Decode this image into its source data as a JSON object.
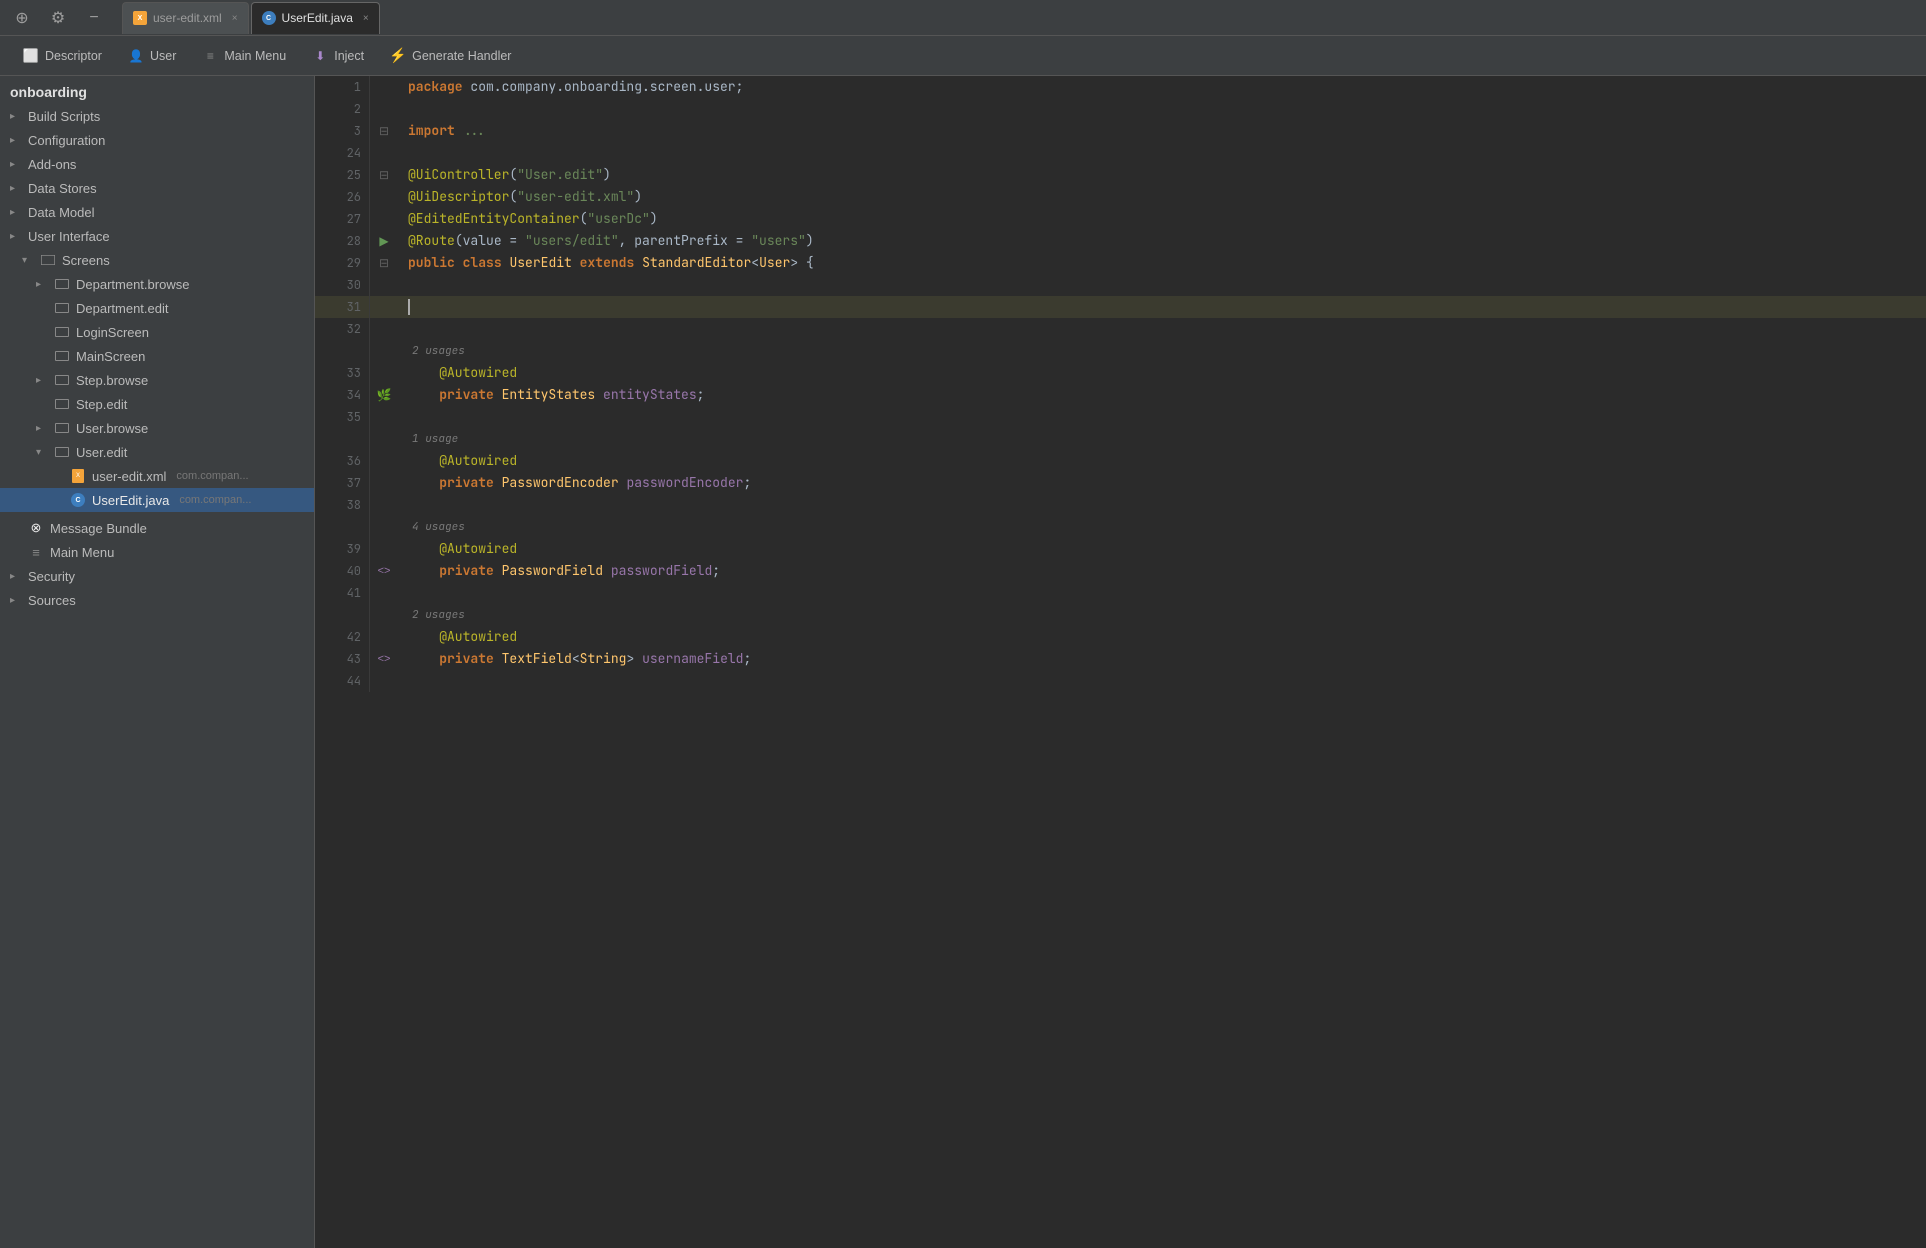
{
  "tabs": [
    {
      "id": "user-edit-xml",
      "label": "user-edit.xml",
      "type": "xml",
      "active": false
    },
    {
      "id": "UserEdit-java",
      "label": "UserEdit.java",
      "type": "java",
      "active": true
    }
  ],
  "toolbar": {
    "buttons": [
      {
        "id": "descriptor",
        "label": "Descriptor",
        "icon": "descriptor-icon"
      },
      {
        "id": "user",
        "label": "User",
        "icon": "user-icon"
      },
      {
        "id": "main-menu",
        "label": "Main Menu",
        "icon": "menu-icon"
      },
      {
        "id": "inject",
        "label": "Inject",
        "icon": "inject-icon"
      },
      {
        "id": "generate-handler",
        "label": "Generate Handler",
        "icon": "generate-icon"
      }
    ]
  },
  "sidebar": {
    "project_name": "onboarding",
    "items": [
      {
        "id": "build-scripts",
        "label": "Build Scripts",
        "indent": 0,
        "type": "item"
      },
      {
        "id": "configuration",
        "label": "Configuration",
        "indent": 0,
        "type": "item"
      },
      {
        "id": "add-ons",
        "label": "Add-ons",
        "indent": 0,
        "type": "item"
      },
      {
        "id": "data-stores",
        "label": "Data Stores",
        "indent": 0,
        "type": "item"
      },
      {
        "id": "data-model",
        "label": "Data Model",
        "indent": 0,
        "type": "item"
      },
      {
        "id": "user-interface",
        "label": "User Interface",
        "indent": 0,
        "type": "item"
      },
      {
        "id": "screens",
        "label": "Screens",
        "indent": 1,
        "type": "folder",
        "expanded": true
      },
      {
        "id": "department-browse",
        "label": "Department.browse",
        "indent": 2,
        "type": "screen"
      },
      {
        "id": "department-edit",
        "label": "Department.edit",
        "indent": 2,
        "type": "screen"
      },
      {
        "id": "login-screen",
        "label": "LoginScreen",
        "indent": 2,
        "type": "screen"
      },
      {
        "id": "main-screen",
        "label": "MainScreen",
        "indent": 2,
        "type": "screen"
      },
      {
        "id": "step-browse",
        "label": "Step.browse",
        "indent": 2,
        "type": "screen"
      },
      {
        "id": "step-edit",
        "label": "Step.edit",
        "indent": 2,
        "type": "screen"
      },
      {
        "id": "user-browse",
        "label": "User.browse",
        "indent": 2,
        "type": "screen"
      },
      {
        "id": "user-edit",
        "label": "User.edit",
        "indent": 2,
        "type": "screen",
        "expanded": true
      },
      {
        "id": "user-edit-xml-file",
        "label": "user-edit.xml",
        "indent": 3,
        "type": "xml",
        "suffix": "com.compan..."
      },
      {
        "id": "UserEdit-java-file",
        "label": "UserEdit.java",
        "indent": 3,
        "type": "java",
        "suffix": "com.compan...",
        "selected": true
      },
      {
        "id": "message-bundle",
        "label": "Message Bundle",
        "indent": 0,
        "type": "item"
      },
      {
        "id": "main-menu-item",
        "label": "Main Menu",
        "indent": 0,
        "type": "item"
      },
      {
        "id": "security",
        "label": "Security",
        "indent": 0,
        "type": "item"
      },
      {
        "id": "sources",
        "label": "Sources",
        "indent": 0,
        "type": "item"
      }
    ]
  },
  "code": {
    "package_line": "package com.company.onboarding.screen.user;",
    "import_line": "import ...",
    "lines": [
      {
        "num": 1,
        "type": "code",
        "content": "package com.company.onboarding.screen.user;"
      },
      {
        "num": 2,
        "type": "empty"
      },
      {
        "num": 3,
        "type": "code",
        "content": "import ..."
      },
      {
        "num": 24,
        "type": "empty"
      },
      {
        "num": 25,
        "type": "annotation",
        "content": "@UiController(\"User.edit\")"
      },
      {
        "num": 26,
        "type": "annotation",
        "content": "@UiDescriptor(\"user-edit.xml\")"
      },
      {
        "num": 27,
        "type": "annotation",
        "content": "@EditedEntityContainer(\"userDc\")"
      },
      {
        "num": 28,
        "type": "annotation",
        "content": "@Route(value = \"users/edit\", parentPrefix = \"users\")"
      },
      {
        "num": 29,
        "type": "code",
        "content": "public class UserEdit extends StandardEditor<User> {"
      },
      {
        "num": 30,
        "type": "empty"
      },
      {
        "num": 31,
        "type": "cursor_line"
      },
      {
        "num": 32,
        "type": "empty"
      },
      {
        "num": 33,
        "type": "usage",
        "content": "2 usages"
      },
      {
        "num": 33,
        "type": "annotation_line",
        "content": "@Autowired"
      },
      {
        "num": 34,
        "type": "code",
        "content": "private EntityStates entityStates;"
      },
      {
        "num": 35,
        "type": "empty"
      },
      {
        "num": 36,
        "type": "usage",
        "content": "1 usage"
      },
      {
        "num": 36,
        "type": "annotation_line",
        "content": "@Autowired"
      },
      {
        "num": 37,
        "type": "code",
        "content": "private PasswordEncoder passwordEncoder;"
      },
      {
        "num": 38,
        "type": "empty"
      },
      {
        "num": 39,
        "type": "usage",
        "content": "4 usages"
      },
      {
        "num": 39,
        "type": "annotation_line",
        "content": "@Autowired"
      },
      {
        "num": 40,
        "type": "code_with_brackets",
        "content": "private PasswordField passwordField;"
      },
      {
        "num": 41,
        "type": "empty"
      },
      {
        "num": 42,
        "type": "usage",
        "content": "2 usages"
      },
      {
        "num": 42,
        "type": "annotation_line",
        "content": "@Autowired"
      },
      {
        "num": 43,
        "type": "code_with_brackets2",
        "content": "private TextField<String> usernameField;"
      },
      {
        "num": 44,
        "type": "empty"
      }
    ]
  },
  "icons": {
    "collapse_arrow": "▸",
    "expand_arrow": "▾",
    "xml_label": "X",
    "java_label": "C",
    "close": "×"
  }
}
